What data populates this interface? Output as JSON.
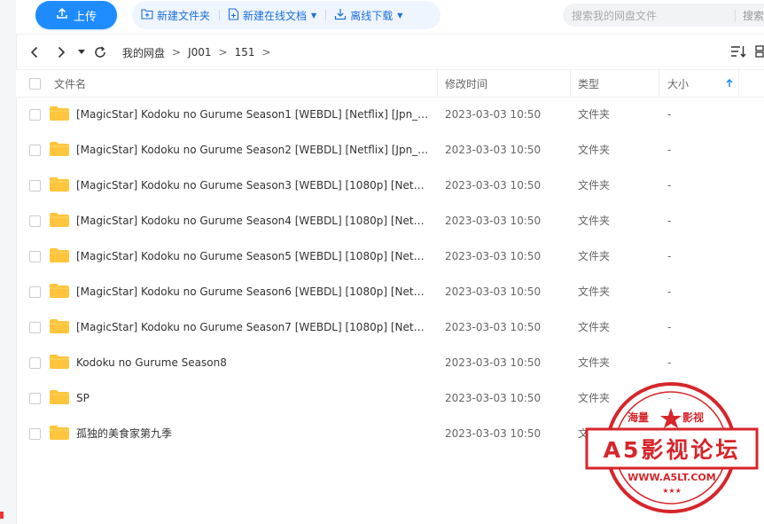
{
  "toolbar": {
    "upload_label": "上传",
    "new_folder_label": "新建文件夹",
    "new_doc_label": "新建在线文档",
    "offline_download_label": "离线下载"
  },
  "search": {
    "placeholder": "搜索我的网盘文件",
    "button_label": "搜索"
  },
  "breadcrumb": {
    "items": [
      "我的网盘",
      "J001",
      "151"
    ],
    "separator": ">"
  },
  "table": {
    "headers": {
      "name": "文件名",
      "time": "修改时间",
      "type": "类型",
      "size": "大小"
    },
    "rows": [
      {
        "name": "[MagicStar] Kodoku no Gurume Season1 [WEBDL] [Netflix] [Jpn_s...",
        "time": "2023-03-03 10:50",
        "type": "文件夹",
        "size": "-"
      },
      {
        "name": "[MagicStar] Kodoku no Gurume Season2 [WEBDL] [Netflix] [Jpn_s...",
        "time": "2023-03-03 10:50",
        "type": "文件夹",
        "size": "-"
      },
      {
        "name": "[MagicStar] Kodoku no Gurume Season3 [WEBDL] [1080p] [Netflix...",
        "time": "2023-03-03 10:50",
        "type": "文件夹",
        "size": "-"
      },
      {
        "name": "[MagicStar] Kodoku no Gurume Season4 [WEBDL] [1080p] [Netflix...",
        "time": "2023-03-03 10:50",
        "type": "文件夹",
        "size": "-"
      },
      {
        "name": "[MagicStar] Kodoku no Gurume Season5 [WEBDL] [1080p] [Netflix...",
        "time": "2023-03-03 10:50",
        "type": "文件夹",
        "size": "-"
      },
      {
        "name": "[MagicStar] Kodoku no Gurume Season6 [WEBDL] [1080p] [Netflix...",
        "time": "2023-03-03 10:50",
        "type": "文件夹",
        "size": "-"
      },
      {
        "name": "[MagicStar] Kodoku no Gurume Season7 [WEBDL] [1080p] [Netflix...",
        "time": "2023-03-03 10:50",
        "type": "文件夹",
        "size": "-"
      },
      {
        "name": "Kodoku no Gurume Season8",
        "time": "2023-03-03 10:50",
        "type": "文件夹",
        "size": "-"
      },
      {
        "name": "SP",
        "time": "2023-03-03 10:50",
        "type": "文件夹",
        "size": "-"
      },
      {
        "name": "孤独的美食家第九季",
        "time": "2023-03-03 10:50",
        "type": "文件夹",
        "size": ""
      }
    ]
  },
  "watermark": {
    "top_left": "海量",
    "top_right": "影视",
    "main": "A5影视论坛",
    "url": "WWW.A5LT.COM"
  },
  "colors": {
    "accent": "#1e8cff",
    "folder": "#ffc53d",
    "watermark": "#d6252b"
  }
}
